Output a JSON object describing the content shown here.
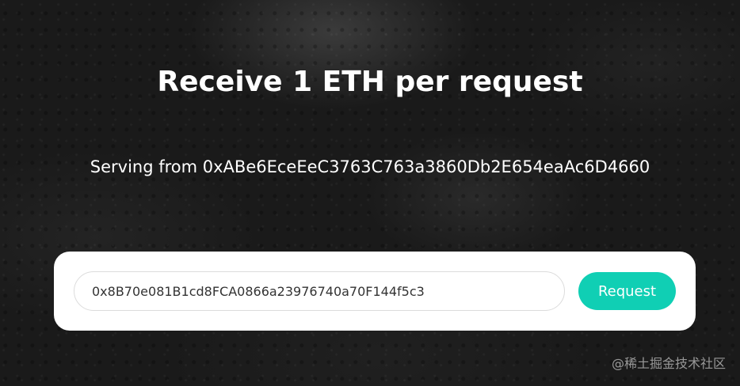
{
  "header": {
    "title": "Receive 1 ETH per request"
  },
  "faucet": {
    "serving_text": "Serving from 0xABe6EceEeC3763C763a3860Db2E654eaAc6D4660"
  },
  "form": {
    "address_value": "0x8B70e081B1cd8FCA0866a23976740a70F144f5c3",
    "request_label": "Request"
  },
  "watermark": {
    "text": "@稀土掘金技术社区"
  },
  "colors": {
    "accent": "#10cfb4",
    "background": "#1a1a1a",
    "card": "#ffffff"
  }
}
